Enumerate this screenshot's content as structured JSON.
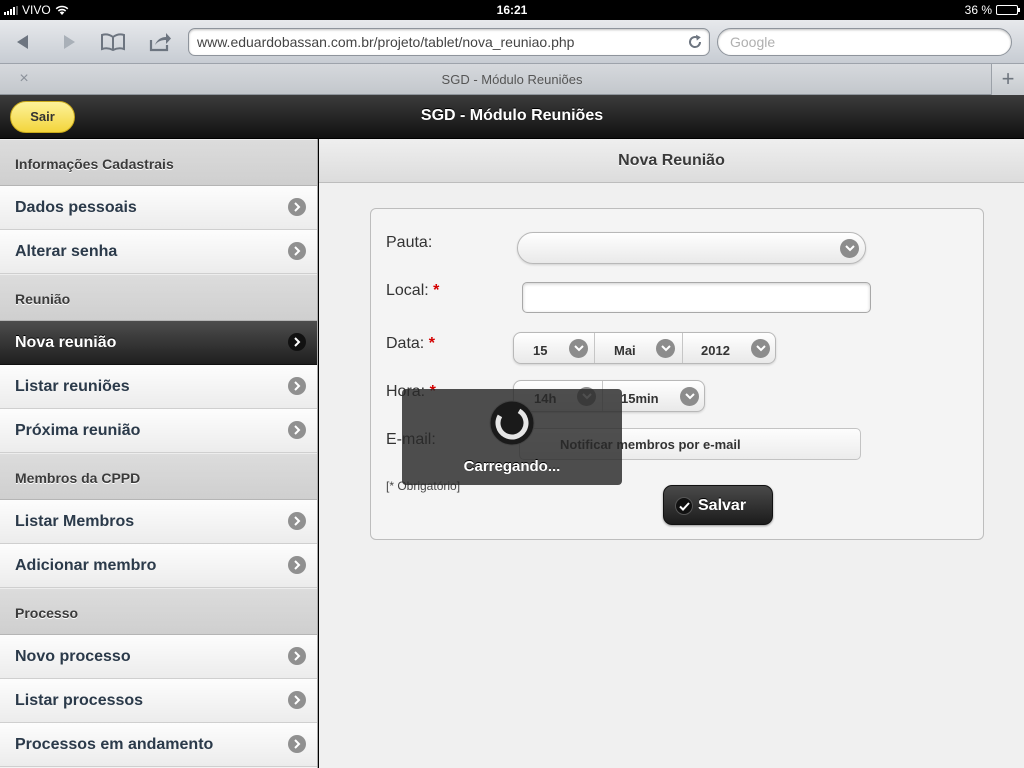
{
  "status": {
    "carrier": "VIVO",
    "time": "16:21",
    "battery": "36 %",
    "battery_level": 0.36
  },
  "browser": {
    "url": "www.eduardobassan.com.br/projeto/tablet/nova_reuniao.php",
    "search_placeholder": "Google",
    "tab_title": "SGD - Módulo Reuniões",
    "tab_close": "×",
    "tab_add": "+"
  },
  "app": {
    "title": "SGD - Módulo Reuniões",
    "sair_label": "Sair"
  },
  "sidebar": {
    "sections": [
      {
        "title": "Informações Cadastrais",
        "items": [
          "Dados pessoais",
          "Alterar senha"
        ]
      },
      {
        "title": "Reunião",
        "items": [
          "Nova reunião",
          "Listar reuniões",
          "Próxima reunião"
        ]
      },
      {
        "title": "Membros da CPPD",
        "items": [
          "Listar Membros",
          "Adicionar membro"
        ]
      },
      {
        "title": "Processo",
        "items": [
          "Novo processo",
          "Listar processos",
          "Processos em andamento"
        ]
      }
    ]
  },
  "form": {
    "title": "Nova Reunião",
    "pauta_label": "Pauta:",
    "local_label": "Local:",
    "data_label": "Data:",
    "hora_label": "Hora:",
    "email_label": "E-mail:",
    "required_mark": "*",
    "pauta_value": "",
    "local_value": "",
    "date_day": "15",
    "date_month": "Mai",
    "date_year": "2012",
    "hora_hour": "14h",
    "hora_min": "15min",
    "notify_label": "Notificar membros por e-mail",
    "obrigatorio": "[* Obrigatório]",
    "save_label": "Salvar"
  },
  "overlay": {
    "text": "Carregando..."
  },
  "colors": {
    "accent_yellow": "#f3d53c",
    "dark_bar": "#1f1f1f",
    "required": "#d40000"
  }
}
